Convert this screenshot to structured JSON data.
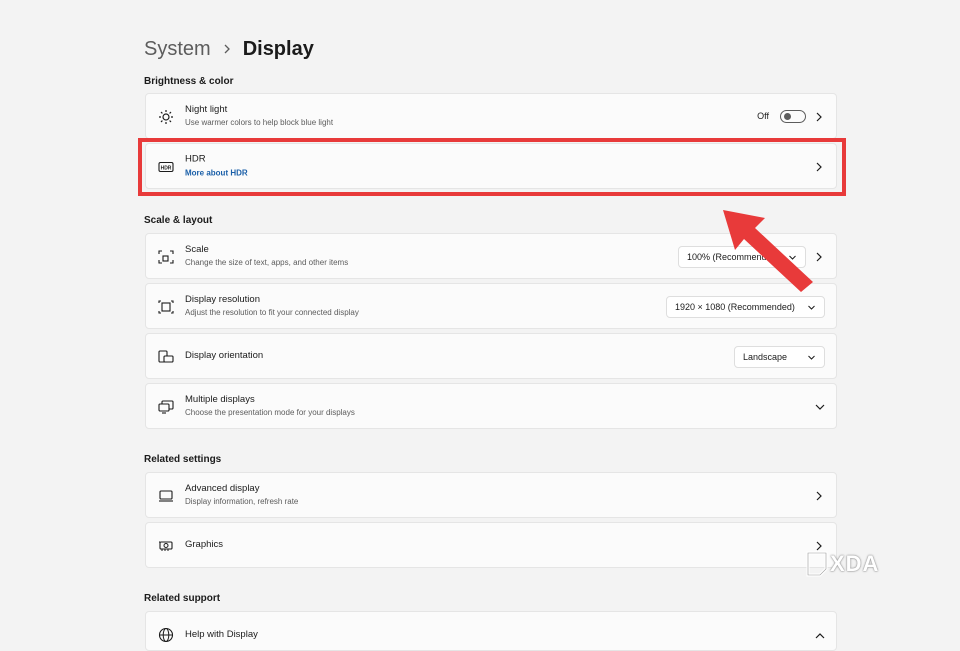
{
  "breadcrumb": {
    "parent": "System",
    "current": "Display"
  },
  "sections": {
    "brightness": "Brightness & color",
    "scale_layout": "Scale & layout",
    "related_settings": "Related settings",
    "related_support": "Related support"
  },
  "night_light": {
    "title": "Night light",
    "desc": "Use warmer colors to help block blue light",
    "state": "Off",
    "icon": "sun-icon"
  },
  "hdr": {
    "title": "HDR",
    "link": "More about HDR",
    "icon": "hdr-icon"
  },
  "scale": {
    "title": "Scale",
    "desc": "Change the size of text, apps, and other items",
    "value": "100% (Recommended)",
    "icon": "scale-icon"
  },
  "resolution": {
    "title": "Display resolution",
    "desc": "Adjust the resolution to fit your connected display",
    "value": "1920 × 1080 (Recommended)",
    "icon": "resolution-icon"
  },
  "orientation": {
    "title": "Display orientation",
    "value": "Landscape",
    "icon": "orientation-icon"
  },
  "multiple": {
    "title": "Multiple displays",
    "desc": "Choose the presentation mode for your displays",
    "icon": "multiple-displays-icon"
  },
  "advanced": {
    "title": "Advanced display",
    "desc": "Display information, refresh rate",
    "icon": "monitor-icon"
  },
  "graphics": {
    "title": "Graphics",
    "icon": "graphics-card-icon"
  },
  "help": {
    "title": "Help with Display",
    "icon": "globe-icon"
  },
  "watermark": {
    "text": "XDA"
  },
  "colors": {
    "highlight": "#e83a3a",
    "link": "#1a5fa8",
    "background": "#f3f3f3",
    "card": "#fbfbfb"
  }
}
